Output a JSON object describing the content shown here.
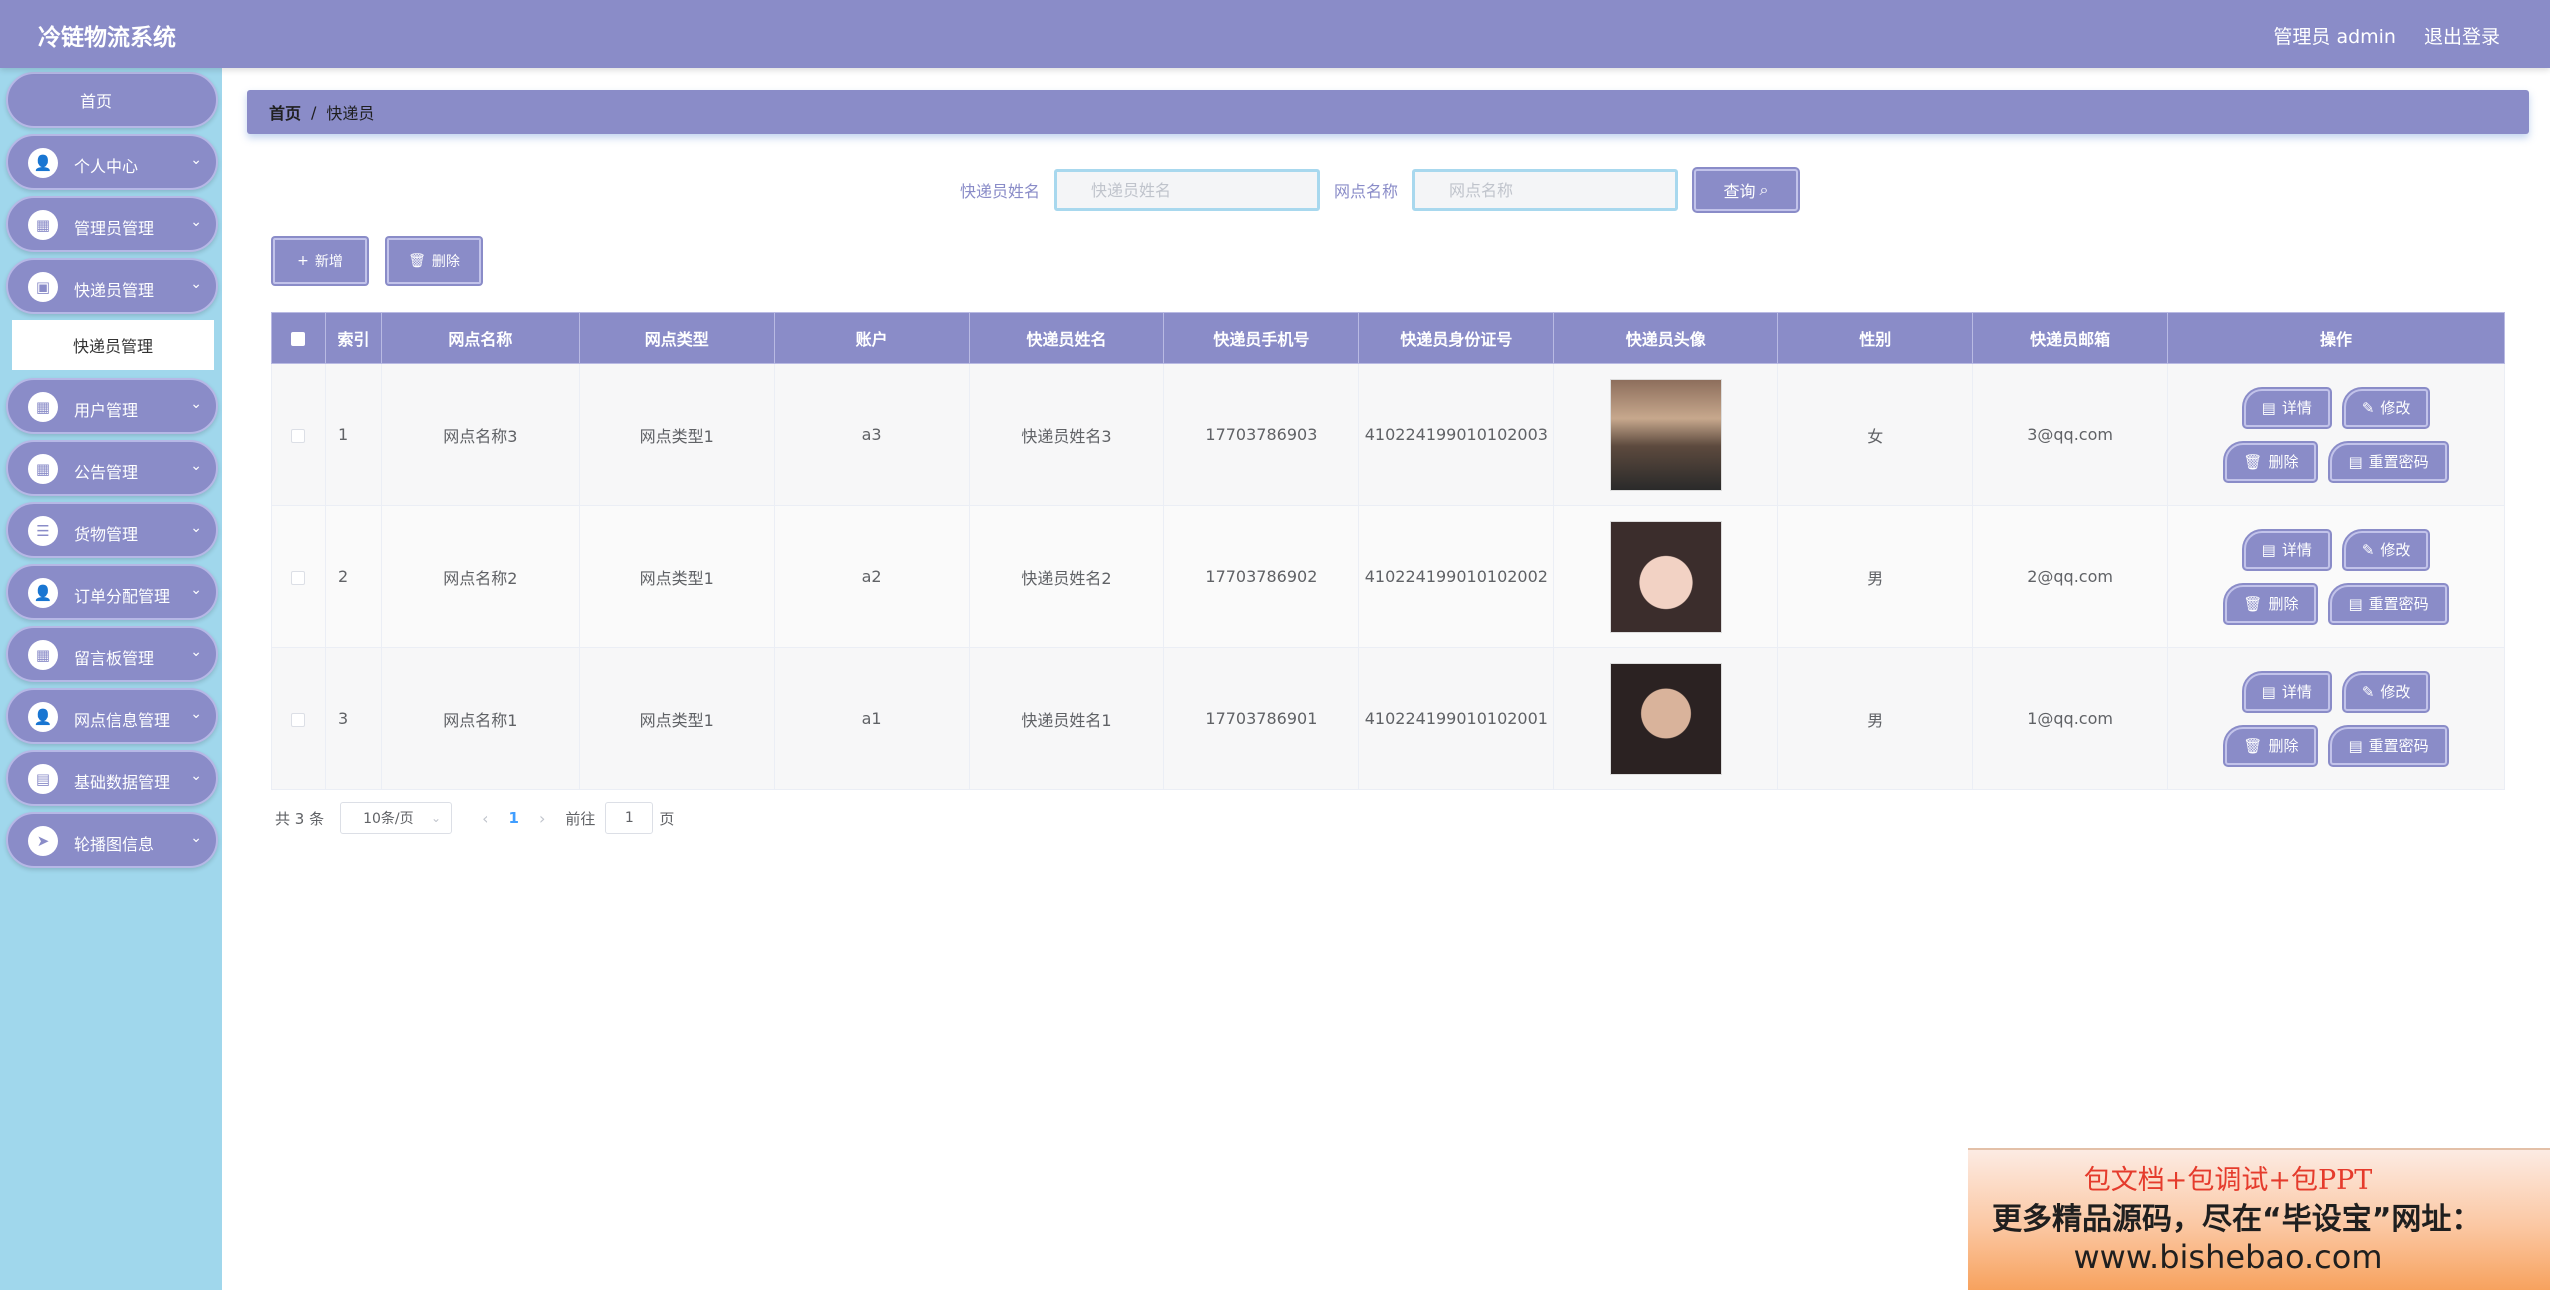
{
  "app": {
    "title": "冷链物流系统"
  },
  "header": {
    "user": "管理员 admin",
    "logout": "退出登录"
  },
  "sidebar": {
    "home": "首页",
    "items": [
      {
        "label": "个人中心",
        "icon": "user-icon"
      },
      {
        "label": "管理员管理",
        "icon": "grid-icon"
      },
      {
        "label": "快递员管理",
        "icon": "briefcase-icon"
      },
      {
        "label": "用户管理",
        "icon": "grid-icon"
      },
      {
        "label": "公告管理",
        "icon": "grid-icon"
      },
      {
        "label": "货物管理",
        "icon": "sliders-icon"
      },
      {
        "label": "订单分配管理",
        "icon": "user-icon"
      },
      {
        "label": "留言板管理",
        "icon": "grid-icon"
      },
      {
        "label": "网点信息管理",
        "icon": "user-icon"
      },
      {
        "label": "基础数据管理",
        "icon": "chat-icon"
      },
      {
        "label": "轮播图信息",
        "icon": "send-icon"
      }
    ],
    "submenu": {
      "label": "快递员管理"
    }
  },
  "breadcrumb": {
    "home": "首页",
    "separator": "/",
    "current": "快递员"
  },
  "search": {
    "name_label": "快递员姓名",
    "name_placeholder": "快递员姓名",
    "site_label": "网点名称",
    "site_placeholder": "网点名称",
    "button": "查询"
  },
  "actions": {
    "add": "新增",
    "delete": "删除"
  },
  "table": {
    "headers": [
      "索引",
      "网点名称",
      "网点类型",
      "账户",
      "快递员姓名",
      "快递员手机号",
      "快递员身份证号",
      "快递员头像",
      "性别",
      "快递员邮箱",
      "操作"
    ],
    "rows": [
      {
        "index": "1",
        "site_name": "网点名称3",
        "site_type": "网点类型1",
        "account": "a3",
        "name": "快递员姓名3",
        "phone": "17703786903",
        "id_card": "410224199010102003",
        "gender": "女",
        "email": "3@qq.com"
      },
      {
        "index": "2",
        "site_name": "网点名称2",
        "site_type": "网点类型1",
        "account": "a2",
        "name": "快递员姓名2",
        "phone": "17703786902",
        "id_card": "410224199010102002",
        "gender": "男",
        "email": "2@qq.com"
      },
      {
        "index": "3",
        "site_name": "网点名称1",
        "site_type": "网点类型1",
        "account": "a1",
        "name": "快递员姓名1",
        "phone": "17703786901",
        "id_card": "410224199010102001",
        "gender": "男",
        "email": "1@qq.com"
      }
    ],
    "ops": {
      "detail": "详情",
      "edit": "修改",
      "delete": "删除",
      "reset": "重置密码"
    }
  },
  "pagination": {
    "total": "共 3 条",
    "page_size": "10条/页",
    "current_page": "1",
    "goto": "前往",
    "goto_value": "1",
    "page_suffix": "页"
  },
  "ad": {
    "line1": "包文档+包调试+包PPT",
    "line2": "更多精品源码，尽在“毕设宝”网址：",
    "line3": "www.bishebao.com"
  },
  "colors": {
    "primary": "#8a8cc8",
    "sidebar_bg": "#a0d7ec",
    "page_link": "#409eff"
  }
}
